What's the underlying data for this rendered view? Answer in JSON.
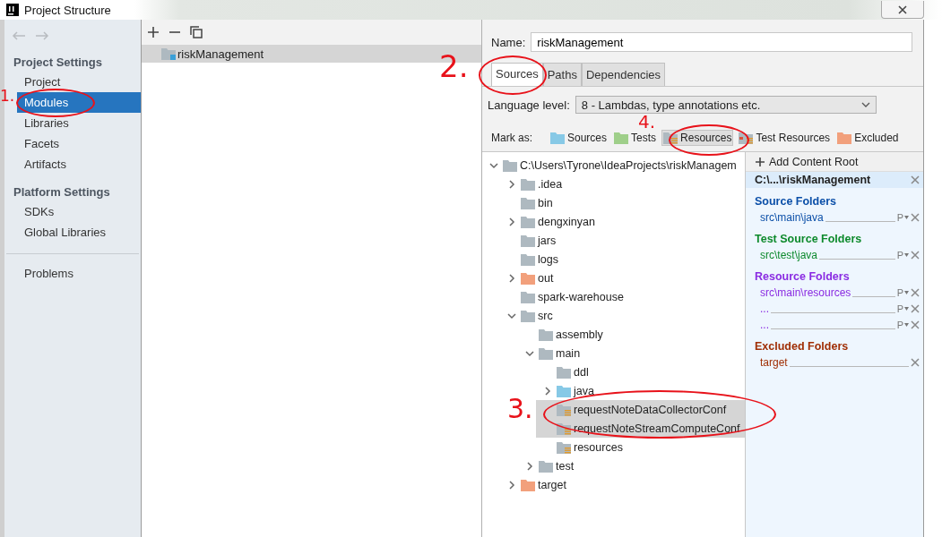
{
  "window": {
    "title": "Project Structure"
  },
  "sidebar": {
    "sections": [
      {
        "title": "Project Settings",
        "items": [
          {
            "label": "Project",
            "selected": false
          },
          {
            "label": "Modules",
            "selected": true
          },
          {
            "label": "Libraries",
            "selected": false
          },
          {
            "label": "Facets",
            "selected": false
          },
          {
            "label": "Artifacts",
            "selected": false
          }
        ]
      },
      {
        "title": "Platform Settings",
        "items": [
          {
            "label": "SDKs",
            "selected": false
          },
          {
            "label": "Global Libraries",
            "selected": false
          }
        ]
      },
      {
        "items": [
          {
            "label": "Problems",
            "selected": false
          }
        ]
      }
    ]
  },
  "modules": [
    {
      "label": "riskManagement",
      "selected": true
    }
  ],
  "name_field": {
    "label": "Name:",
    "value": "riskManagement"
  },
  "tabs": [
    {
      "label": "Sources",
      "selected": true
    },
    {
      "label": "Paths",
      "selected": false
    },
    {
      "label": "Dependencies",
      "selected": false
    }
  ],
  "language_level": {
    "label": "Language level:",
    "value": "8 - Lambdas, type annotations etc."
  },
  "mark_as": {
    "label": "Mark as:",
    "buttons": [
      {
        "label": "Sources",
        "kind": "source",
        "selected": false
      },
      {
        "label": "Tests",
        "kind": "test",
        "selected": false
      },
      {
        "label": "Resources",
        "kind": "resource",
        "selected": true
      },
      {
        "label": "Test Resources",
        "kind": "test_resource",
        "selected": false
      },
      {
        "label": "Excluded",
        "kind": "excluded",
        "selected": false
      }
    ]
  },
  "tree": {
    "label": "C:\\Users\\Tyrone\\IdeaProjects\\riskManagem",
    "kind": "plain",
    "expanded": true,
    "selected": false,
    "children": [
      {
        "label": ".idea",
        "kind": "plain",
        "expanded": false,
        "selected": false
      },
      {
        "label": "bin",
        "kind": "plain",
        "selected": false
      },
      {
        "label": "dengxinyan",
        "kind": "plain",
        "expanded": false,
        "selected": false
      },
      {
        "label": "jars",
        "kind": "plain",
        "selected": false
      },
      {
        "label": "logs",
        "kind": "plain",
        "selected": false
      },
      {
        "label": "out",
        "kind": "excluded",
        "expanded": false,
        "selected": false
      },
      {
        "label": "spark-warehouse",
        "kind": "plain",
        "selected": false
      },
      {
        "label": "src",
        "kind": "plain",
        "expanded": true,
        "selected": false,
        "children": [
          {
            "label": "assembly",
            "kind": "plain",
            "selected": false
          },
          {
            "label": "main",
            "kind": "plain",
            "expanded": true,
            "selected": false,
            "children": [
              {
                "label": "ddl",
                "kind": "plain",
                "selected": false
              },
              {
                "label": "java",
                "kind": "source",
                "expanded": false,
                "selected": false
              },
              {
                "label": "requestNoteDataCollectorConf",
                "kind": "resource",
                "selected": true
              },
              {
                "label": "requestNoteStreamComputeConf",
                "kind": "resource",
                "selected": true
              },
              {
                "label": "resources",
                "kind": "resource",
                "selected": false
              }
            ]
          },
          {
            "label": "test",
            "kind": "plain",
            "expanded": false,
            "selected": false
          }
        ]
      },
      {
        "label": "target",
        "kind": "excluded",
        "expanded": false,
        "selected": false
      }
    ]
  },
  "content_roots": {
    "add_label": "Add Content Root",
    "root": "C:\\...\\riskManagement",
    "sections": [
      {
        "title": "Source Folders",
        "kind": "source",
        "items": [
          {
            "path": "src\\main\\java",
            "prefix": "P"
          }
        ]
      },
      {
        "title": "Test Source Folders",
        "kind": "test",
        "items": [
          {
            "path": "src\\test\\java",
            "prefix": "P"
          }
        ]
      },
      {
        "title": "Resource Folders",
        "kind": "resource",
        "items": [
          {
            "path": "src\\main\\resources",
            "prefix": "P"
          },
          {
            "path": "...",
            "prefix": "P"
          },
          {
            "path": "...",
            "prefix": "P"
          }
        ]
      },
      {
        "title": "Excluded Folders",
        "kind": "excluded",
        "items": [
          {
            "path": "target"
          }
        ]
      }
    ]
  },
  "annotations": [
    {
      "label": "1."
    },
    {
      "label": "2."
    },
    {
      "label": "3."
    },
    {
      "label": "4."
    }
  ]
}
